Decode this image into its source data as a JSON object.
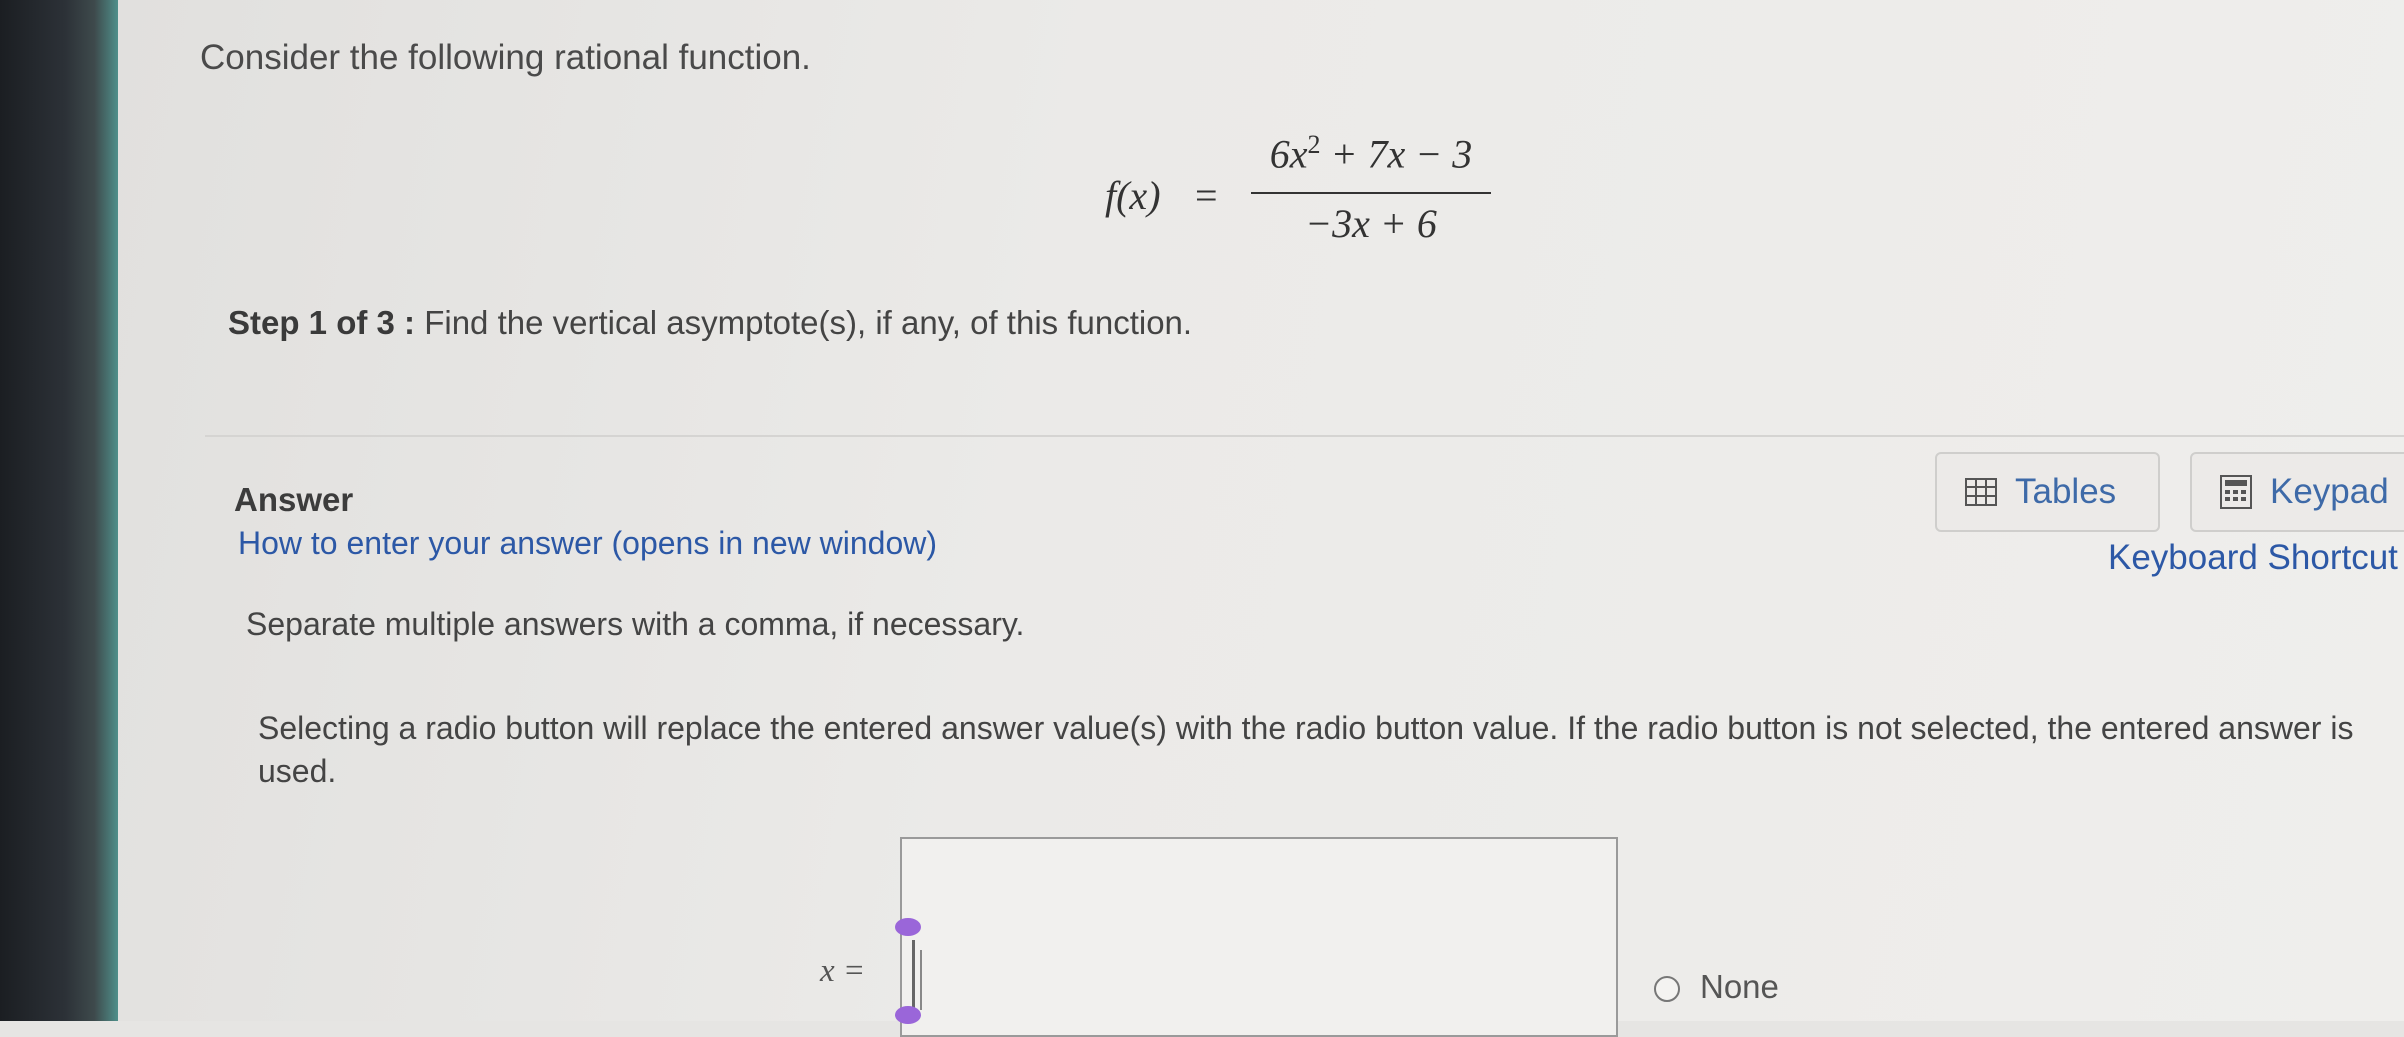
{
  "question": {
    "intro": "Consider the following rational function.",
    "function": {
      "lhs": "f(x)",
      "equals": "=",
      "numerator": {
        "lead": "6x",
        "exp": "2",
        "rest": " + 7x − 3"
      },
      "denominator": "−3x + 6"
    },
    "step_label": "Step 1 of 3 :",
    "step_text": " Find the vertical asymptote(s), if any, of this function."
  },
  "answer": {
    "heading": "Answer",
    "how_to_link": "How to enter your answer (opens in new window)",
    "separate_note": "Separate multiple answers with a comma, if necessary.",
    "radio_note": "Selecting a radio button will replace the entered answer value(s) with the radio button value. If the radio button is not selected, the entered answer is used.",
    "input_label": "x =",
    "input_value": "",
    "radio_option": "None"
  },
  "toolbar": {
    "tables_label": "Tables",
    "keypad_label": "Keypad",
    "shortcuts_link": "Keyboard Shortcut"
  },
  "colors": {
    "link": "#2c58a6",
    "cursor_handle": "#9a66d9"
  },
  "icons": [
    "table-icon",
    "keypad-icon"
  ]
}
